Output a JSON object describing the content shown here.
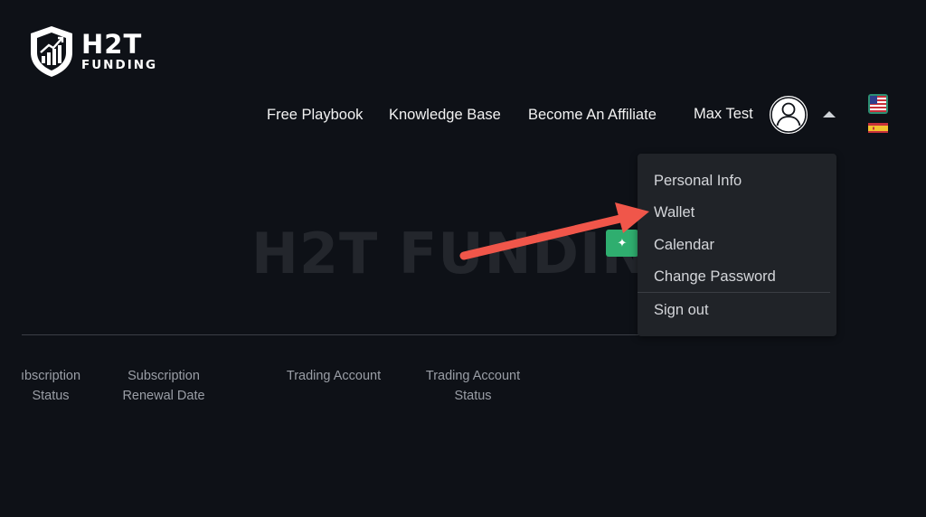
{
  "logo": {
    "main": "H2T",
    "sub": "FUNDING"
  },
  "nav": {
    "links": [
      {
        "label": "Free Playbook"
      },
      {
        "label": "Knowledge Base"
      },
      {
        "label": "Become An Affiliate"
      }
    ],
    "user_name": "Max Test"
  },
  "watermark": "H2T FUNDING",
  "dropdown": {
    "items": [
      {
        "label": "Personal Info"
      },
      {
        "label": "Wallet"
      },
      {
        "label": "Calendar"
      },
      {
        "label": "Change Password"
      },
      {
        "label": "Sign out"
      }
    ]
  },
  "table": {
    "headers": [
      {
        "line1": "ıbscription",
        "line2": "Status"
      },
      {
        "line1": "Subscription",
        "line2": "Renewal Date"
      },
      {
        "line1": "Trading Account",
        "line2": ""
      },
      {
        "line1": "Trading Account",
        "line2": "Status"
      }
    ]
  },
  "icons": {
    "logo": "shield-chart-icon",
    "avatar": "user-avatar-icon",
    "caret": "caret-up-icon",
    "flag_us": "us-flag-icon",
    "flag_es": "spain-flag-icon",
    "annotation": "red-arrow-icon"
  },
  "colors": {
    "background": "#0e1117",
    "dropdown_bg": "#202328",
    "accent_green": "#2fae6f",
    "annotation_red": "#f0564a"
  }
}
